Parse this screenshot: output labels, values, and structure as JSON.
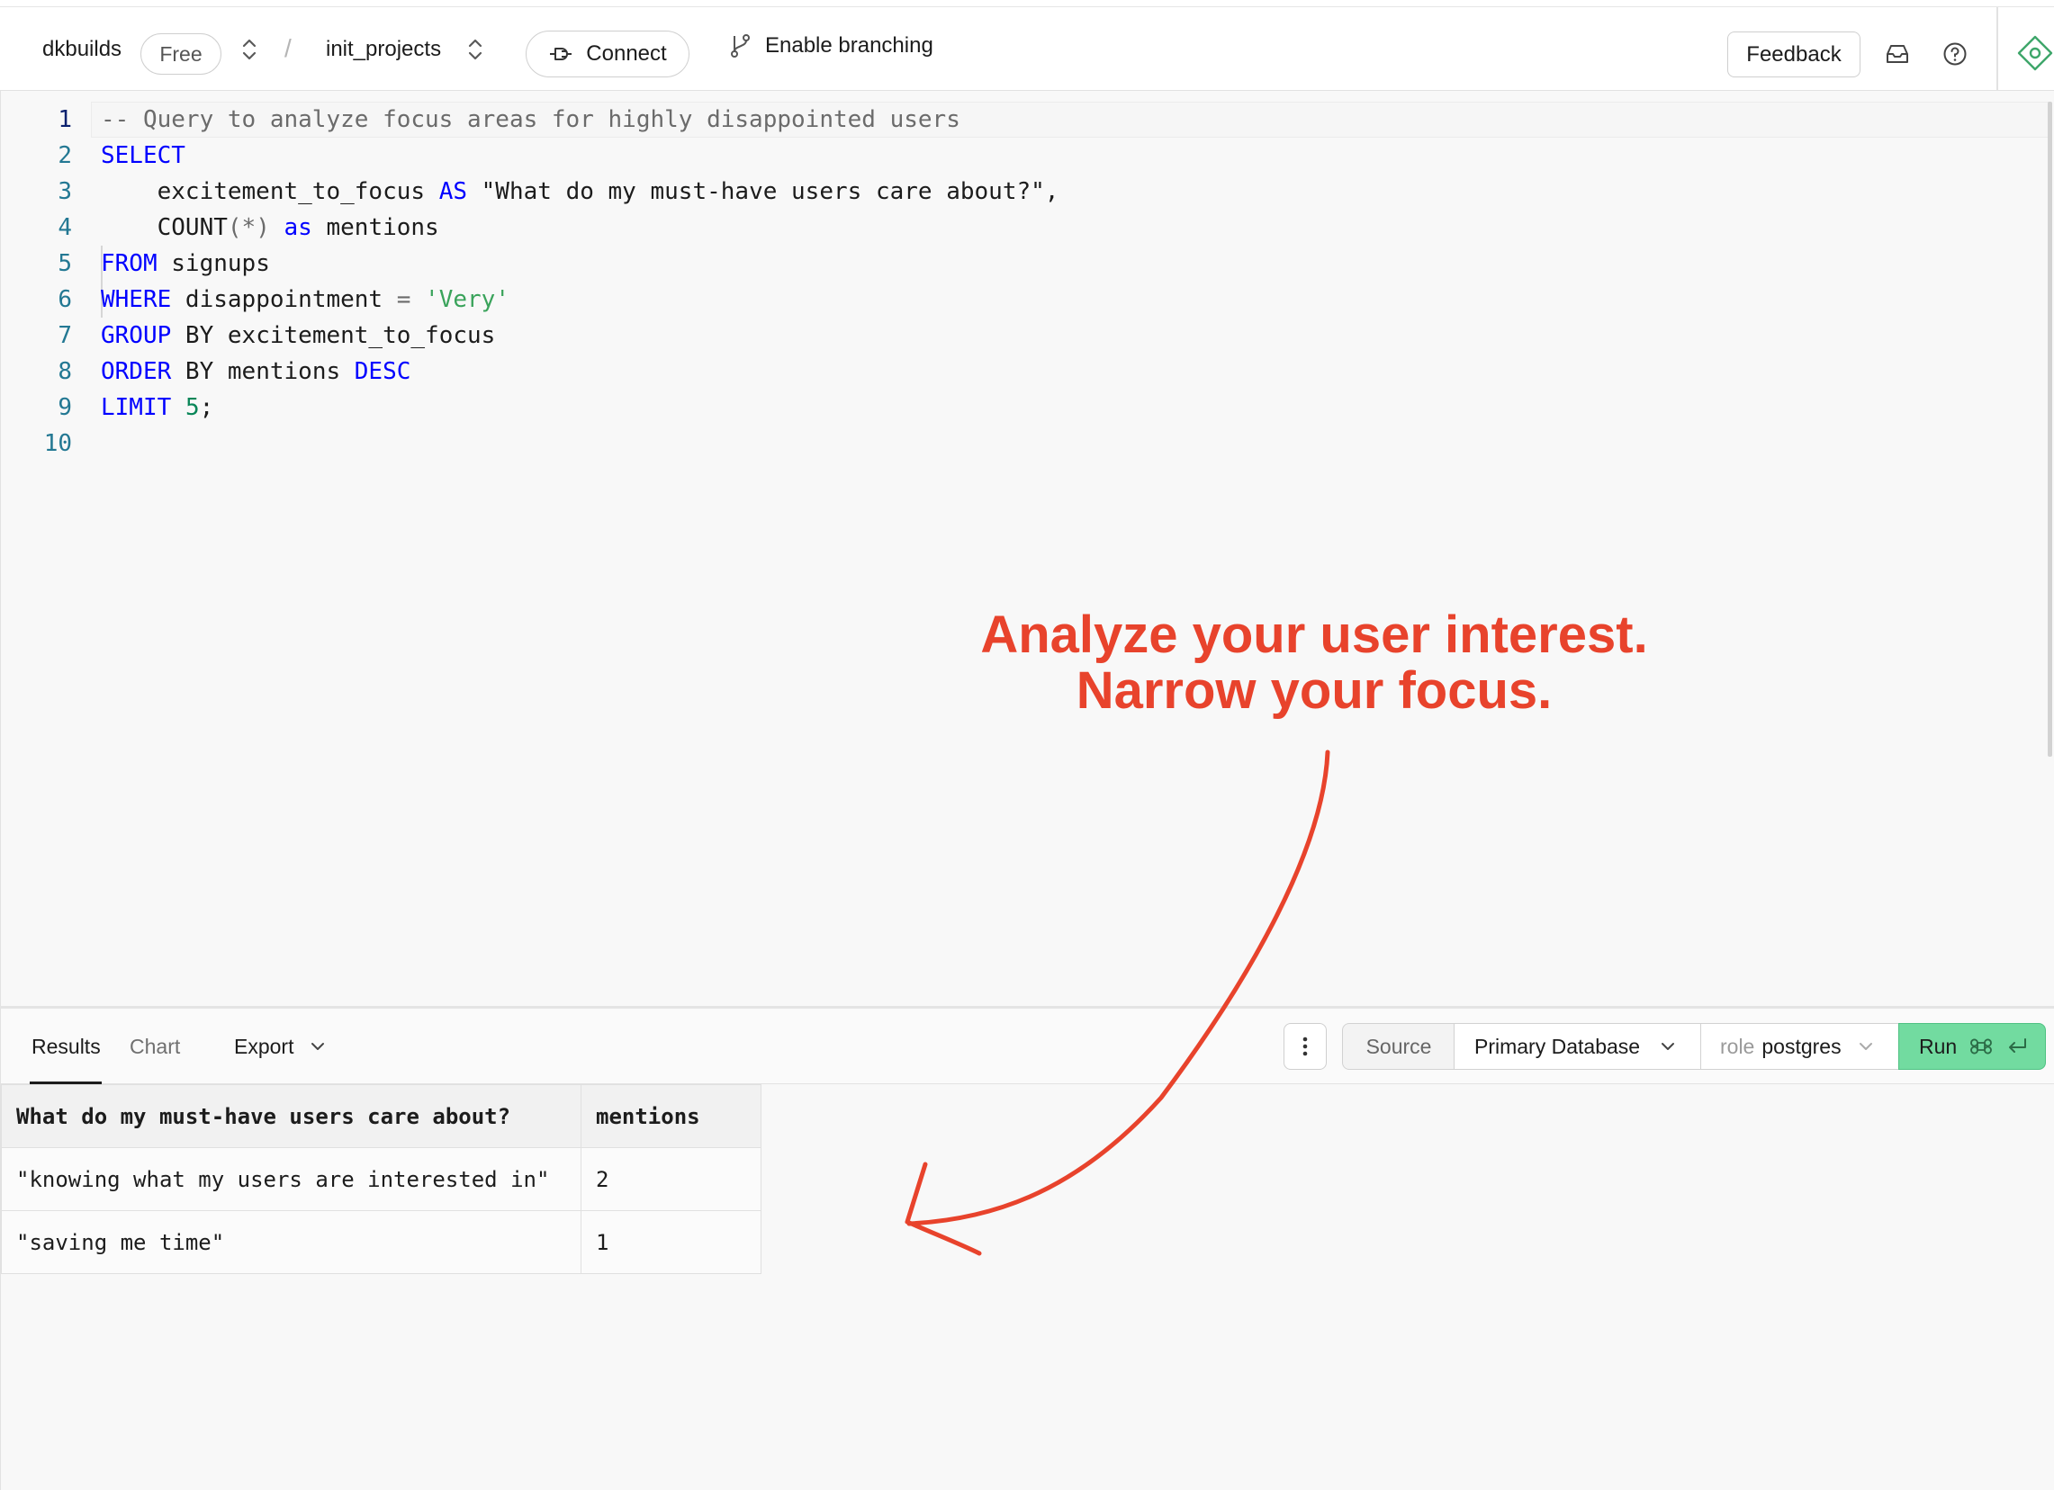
{
  "topbar": {
    "org_name": "dkbuilds",
    "plan_badge": "Free",
    "separator": "/",
    "project_name": "init_projects",
    "connect_label": "Connect",
    "branching_label": "Enable branching",
    "feedback_label": "Feedback"
  },
  "editor": {
    "line_numbers": [
      "1",
      "2",
      "3",
      "4",
      "5",
      "6",
      "7",
      "8",
      "9",
      "10"
    ],
    "lines": [
      [
        {
          "t": "-- Query to analyze focus areas for highly disappointed users",
          "c": "cm"
        }
      ],
      [
        {
          "t": "SELECT",
          "c": "kw"
        }
      ],
      [
        {
          "t": "    excitement_to_focus ",
          "c": ""
        },
        {
          "t": "AS",
          "c": "kw"
        },
        {
          "t": " \"What do my must-have users care about?\",",
          "c": "str"
        }
      ],
      [
        {
          "t": "    COUNT",
          "c": ""
        },
        {
          "t": "(*)",
          "c": "op"
        },
        {
          "t": " ",
          "c": ""
        },
        {
          "t": "as",
          "c": "kw"
        },
        {
          "t": " mentions",
          "c": ""
        }
      ],
      [
        {
          "t": "FROM",
          "c": "kw"
        },
        {
          "t": " signups",
          "c": ""
        }
      ],
      [
        {
          "t": "WHERE",
          "c": "kw"
        },
        {
          "t": " disappointment ",
          "c": ""
        },
        {
          "t": "=",
          "c": "op"
        },
        {
          "t": " ",
          "c": ""
        },
        {
          "t": "'Very'",
          "c": "sq"
        }
      ],
      [
        {
          "t": "GROUP",
          "c": "kw"
        },
        {
          "t": " BY excitement_to_focus",
          "c": ""
        }
      ],
      [
        {
          "t": "ORDER",
          "c": "kw"
        },
        {
          "t": " BY mentions ",
          "c": ""
        },
        {
          "t": "DESC",
          "c": "kw"
        }
      ],
      [
        {
          "t": "LIMIT",
          "c": "kw"
        },
        {
          "t": " ",
          "c": ""
        },
        {
          "t": "5",
          "c": "num"
        },
        {
          "t": ";",
          "c": ""
        }
      ],
      []
    ]
  },
  "annotation": {
    "line1": "Analyze your user interest.",
    "line2": "Narrow your focus."
  },
  "results": {
    "tabs": {
      "results": "Results",
      "chart": "Chart",
      "export": "Export"
    },
    "source_label": "Source",
    "database_label": "Primary Database",
    "role_label": "role",
    "role_value": "postgres",
    "run_label": "Run",
    "columns": [
      "What do my must-have users care about?",
      "mentions"
    ],
    "rows": [
      [
        "\"knowing what my users are interested in\"",
        "2"
      ],
      [
        "\"saving me time\"",
        "1"
      ]
    ]
  },
  "colors": {
    "accent_annotation": "#e8432c",
    "run_button": "#72dba0",
    "keyword": "#0000ff"
  },
  "icons": [
    "chevron-up-down-icon",
    "plug-icon",
    "git-branch-icon",
    "inbox-icon",
    "help-circle-icon",
    "diamond-logo-icon",
    "chevron-down-icon",
    "more-vertical-icon",
    "command-icon",
    "enter-icon"
  ]
}
